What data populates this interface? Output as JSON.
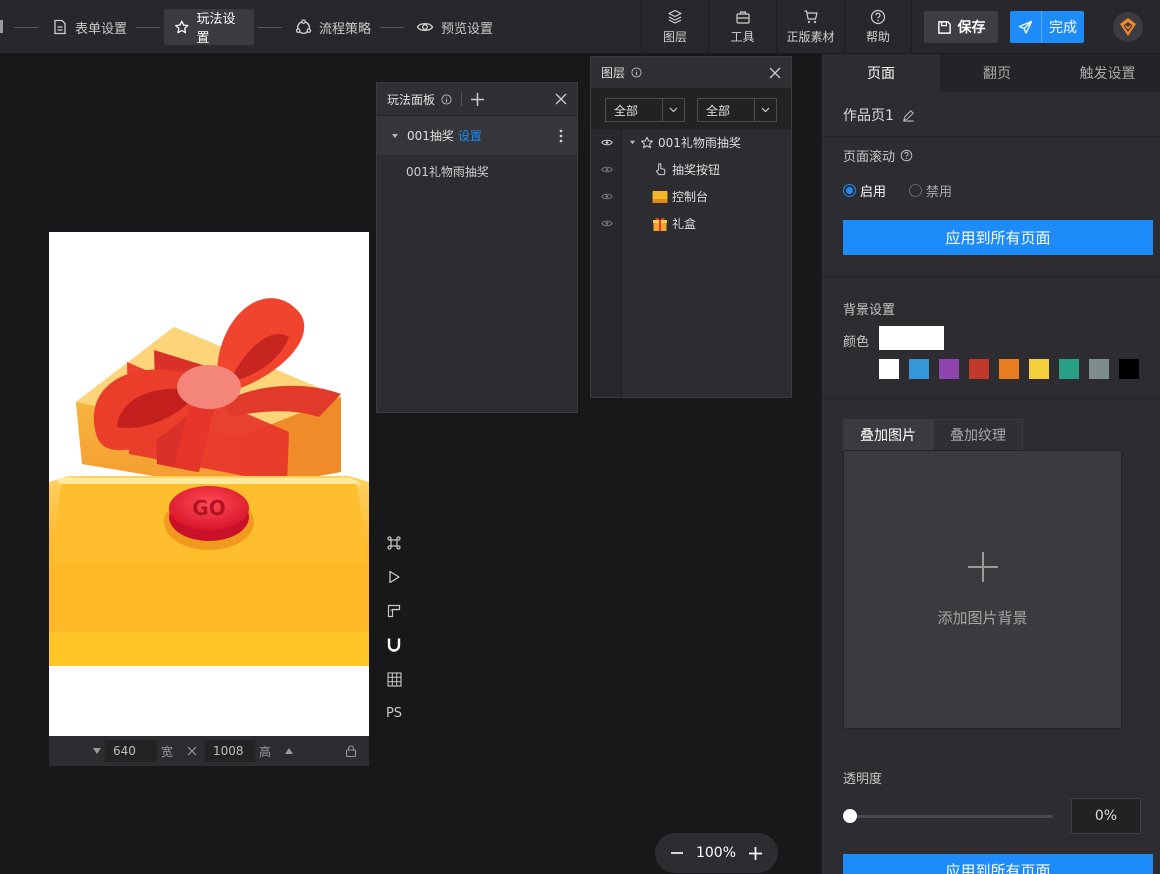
{
  "topbar": {
    "steps": [
      {
        "label": "表单设置",
        "icon": "form-icon"
      },
      {
        "label": "玩法设置",
        "icon": "star-settings-icon",
        "active": true
      },
      {
        "label": "流程策略",
        "icon": "flow-icon"
      },
      {
        "label": "预览设置",
        "icon": "eye-icon"
      }
    ],
    "tools": [
      {
        "label": "图层",
        "icon": "layers-icon"
      },
      {
        "label": "工具",
        "icon": "toolbox-icon"
      },
      {
        "label": "正版素材",
        "icon": "cart-icon"
      },
      {
        "label": "帮助",
        "icon": "help-icon"
      }
    ],
    "save_label": "保存",
    "done_label": "完成",
    "brand_color": "#1d8cf8"
  },
  "play_panel": {
    "title": "玩法面板",
    "group_label": "001抽奖",
    "group_link": "设置",
    "item_label": "001礼物雨抽奖"
  },
  "layer_panel": {
    "title": "图层",
    "filter1": "全部",
    "filter2": "全部",
    "root_label": "001礼物雨抽奖",
    "children": [
      {
        "label": "抽奖按钮",
        "icon": "hand-pointer-icon"
      },
      {
        "label": "控制台",
        "icon": "console-icon"
      },
      {
        "label": "礼盒",
        "icon": "gift-icon"
      }
    ]
  },
  "canvas": {
    "width_value": "640",
    "width_unit": "宽",
    "height_value": "1008",
    "height_unit": "高",
    "go_text": "GO",
    "zoom": "100%"
  },
  "side_tools": [
    "command-icon",
    "play-icon",
    "ruler-icon",
    "magnet-icon",
    "grid-icon",
    "PS"
  ],
  "right_panel": {
    "tabs": [
      "页面",
      "翻页",
      "触发设置"
    ],
    "page_name": "作品页1",
    "scroll_title": "页面滚动",
    "enable_label": "启用",
    "disable_label": "禁用",
    "apply_all": "应用到所有页面",
    "bg_title": "背景设置",
    "color_label": "颜色",
    "current_color": "#ffffff",
    "swatches": [
      "#ffffff",
      "#3498db",
      "#8e44ad",
      "#c0392b",
      "#e67e22",
      "#f4d03f",
      "#27a085",
      "#7f8c8d",
      "#000000"
    ],
    "bg_tabs": [
      "叠加图片",
      "叠加纹理"
    ],
    "add_bg_label": "添加图片背景",
    "opacity_label": "透明度",
    "opacity_value": "0%",
    "opacity_fraction": 0,
    "apply_all_bottom": "应用到所有页面"
  }
}
